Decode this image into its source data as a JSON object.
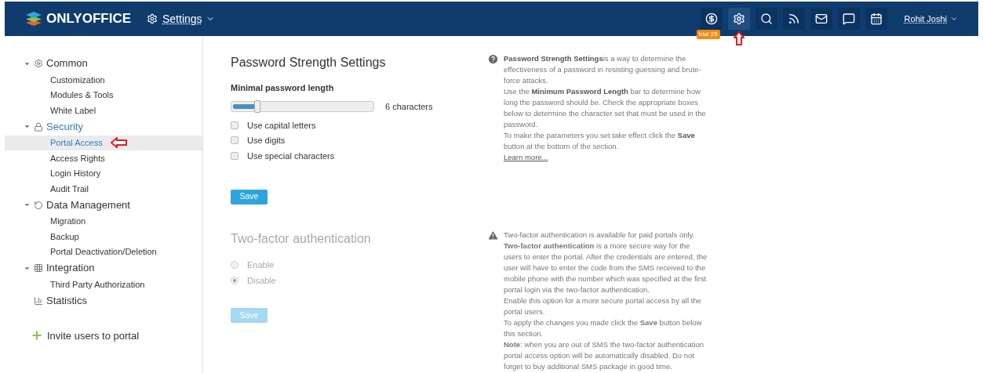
{
  "header": {
    "logo": "ONLYOFFICE",
    "module": "Settings",
    "user": "Rohit Joshi",
    "tools": [
      {
        "kind": "payment",
        "badge": "trial 25"
      },
      {
        "kind": "settings",
        "selected": true
      },
      {
        "kind": "search"
      },
      {
        "kind": "feed"
      },
      {
        "kind": "mail"
      },
      {
        "kind": "chat"
      },
      {
        "kind": "calendar"
      }
    ]
  },
  "sidebar": {
    "groups": [
      {
        "label": "Common",
        "kind": "gear",
        "expanded": true,
        "selected": false,
        "children": [
          {
            "label": "Customization",
            "selected": false
          },
          {
            "label": "Modules & Tools",
            "selected": false
          },
          {
            "label": "White Label",
            "selected": false
          }
        ]
      },
      {
        "label": "Security",
        "kind": "lock",
        "expanded": true,
        "selected": true,
        "children": [
          {
            "label": "Portal Access",
            "selected": true
          },
          {
            "label": "Access Rights",
            "selected": false
          },
          {
            "label": "Login History",
            "selected": false
          },
          {
            "label": "Audit Trail",
            "selected": false
          }
        ]
      },
      {
        "label": "Data Management",
        "kind": "restore",
        "expanded": true,
        "selected": false,
        "children": [
          {
            "label": "Migration",
            "selected": false
          },
          {
            "label": "Backup",
            "selected": false
          },
          {
            "label": "Portal Deactivation/Deletion",
            "selected": false
          }
        ]
      },
      {
        "label": "Integration",
        "kind": "grid",
        "expanded": true,
        "selected": false,
        "children": [
          {
            "label": "Third Party Authorization",
            "selected": false
          }
        ]
      },
      {
        "label": "Statistics",
        "kind": "bars",
        "selected": false
      }
    ],
    "invite": "Invite users to portal"
  },
  "password": {
    "title": "Password Strength Settings",
    "label": "Minimal password length",
    "level": 0.18,
    "reading": "6 characters",
    "options": [
      {
        "label": "Use capital letters",
        "checked": false
      },
      {
        "label": "Use digits",
        "checked": false
      },
      {
        "label": "Use special characters",
        "checked": false
      }
    ],
    "save": "Save",
    "help": [
      "**Password Strength Settings**is a way to determine the effectiveness of a password in resisting guessing and brute-force attacks.",
      "Use the **Minimum Password Length** bar to determine how long the password should be. Check the appropriate boxes below to determine the character set that must be used in the password.",
      "To make the parameters you set take effect click the **Save** button at the bottom of the section."
    ],
    "learn_more": "Learn more..."
  },
  "two_factor": {
    "title": "Two-factor authentication",
    "disabled": true,
    "options": [
      {
        "label": "Enable",
        "selected": false
      },
      {
        "label": "Disable",
        "selected": true
      }
    ],
    "save": "Save",
    "help": [
      "Two-factor authentication is available for paid portals only.",
      "**Two-factor authentication** is a more secure way for the users to enter the portal. After the credentials are entered, the user will have to enter the code from the SMS received to the mobile phone with the number which was specified at the first portal login via the two-factor authentication.",
      "Enable this option for a more secure portal access by all the portal users.",
      "To apply the changes you made click the **Save** button below this section.",
      "**Note**: when you are out of SMS the two-factor authentication portal access option will be automatically disabled. Do not forget to buy additional SMS package in good time."
    ]
  }
}
